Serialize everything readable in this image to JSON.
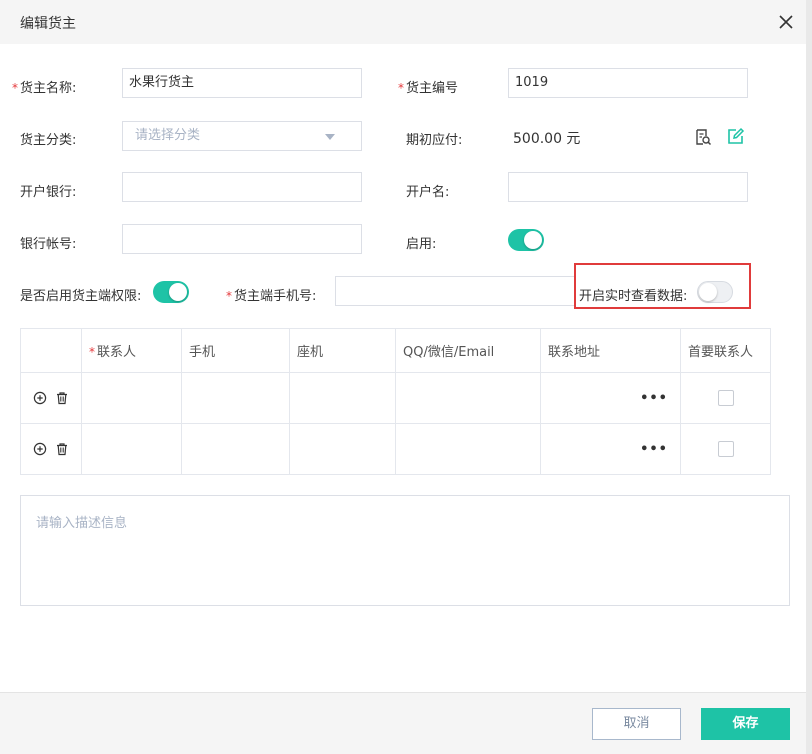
{
  "dialog": {
    "title": "编辑货主"
  },
  "form": {
    "owner_name": {
      "label": "货主名称:",
      "value": "水果行货主"
    },
    "owner_code": {
      "label": "货主编号",
      "value": "1019"
    },
    "category": {
      "label": "货主分类:",
      "placeholder": "请选择分类"
    },
    "opening_payable": {
      "label": "期初应付:",
      "value": "500.00 元"
    },
    "bank": {
      "label": "开户银行:",
      "value": ""
    },
    "account_name": {
      "label": "开户名:",
      "value": ""
    },
    "bank_account": {
      "label": "银行帐号:",
      "value": ""
    },
    "enabled": {
      "label": "启用:",
      "on": true
    },
    "owner_permission": {
      "label": "是否启用货主端权限:",
      "on": true
    },
    "owner_phone": {
      "label": "货主端手机号:",
      "value": ""
    },
    "realtime": {
      "label": "开启实时查看数据:",
      "on": false
    }
  },
  "contacts": {
    "headers": [
      "",
      "联系人",
      "手机",
      "座机",
      "QQ/微信/Email",
      "联系地址",
      "首要联系人"
    ],
    "more_label": "•••"
  },
  "description": {
    "placeholder": "请输入描述信息"
  },
  "footer": {
    "cancel_label": "取消",
    "save_label": "保存"
  },
  "colors": {
    "accent": "#1ec3a6",
    "highlight": "#e03b3b",
    "required": "#e4393c"
  }
}
